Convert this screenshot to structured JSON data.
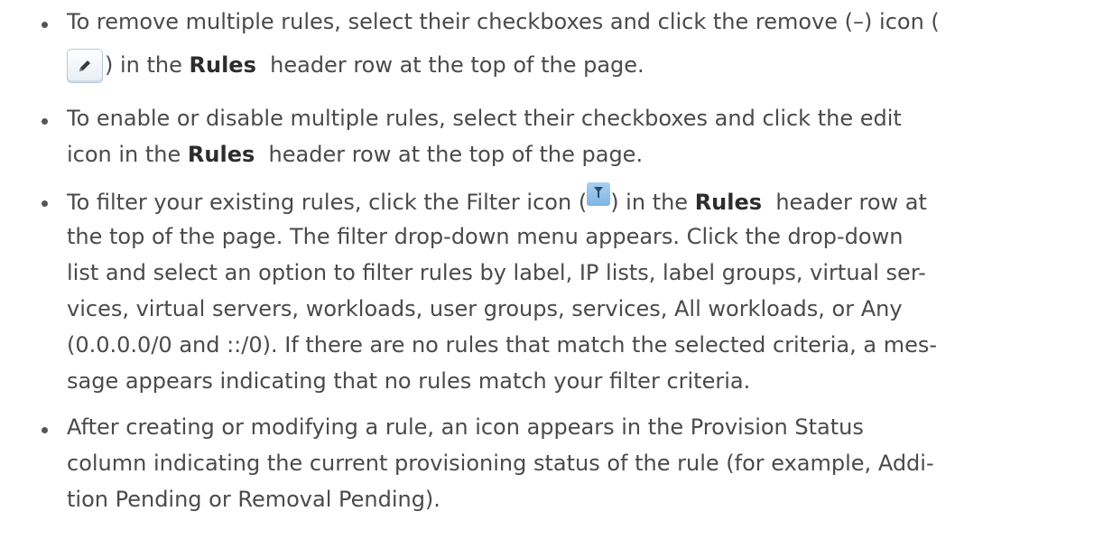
{
  "bullets": [
    {
      "id": "remove-multiple-rules",
      "line1": "To remove multiple rules, select their checkboxes and click the remove (–) icon (",
      "line2_after_icon": ") in the ",
      "line2_keyword": "Rules",
      "line2_end": "  header row at the top of the page.",
      "icon": "pencil-edit-icon"
    },
    {
      "id": "enable-disable-rules",
      "line1": "To enable or disable multiple rules, select their checkboxes and click the edit",
      "line2_start": "icon in the ",
      "line2_keyword": "Rules",
      "line2_end": "  header row at the top of the page."
    },
    {
      "id": "filter-rules",
      "line1_start": "To filter your existing rules, click the Filter icon (",
      "line1_mid": ") in the ",
      "line1_keyword": "Rules",
      "line1_end": "  header row at",
      "icon": "filter-icon",
      "lines": [
        "the top of the page. The filter drop-down menu appears. Click the drop-down",
        "list and select an option to filter rules by label, IP lists, label groups, virtual ser-",
        "vices, virtual servers, workloads, user groups, services, All workloads, or Any",
        "(0.0.0.0/0 and ::/0). If there are no rules that match the selected criteria, a mes-",
        "sage appears indicating that no rules match your filter criteria."
      ]
    },
    {
      "id": "provision-status",
      "lines": [
        "After creating or modifying a rule, an icon appears in the Provision Status",
        "column indicating the current provisioning status of the rule (for example, Addi-",
        "tion Pending or Removal Pending)."
      ]
    }
  ]
}
